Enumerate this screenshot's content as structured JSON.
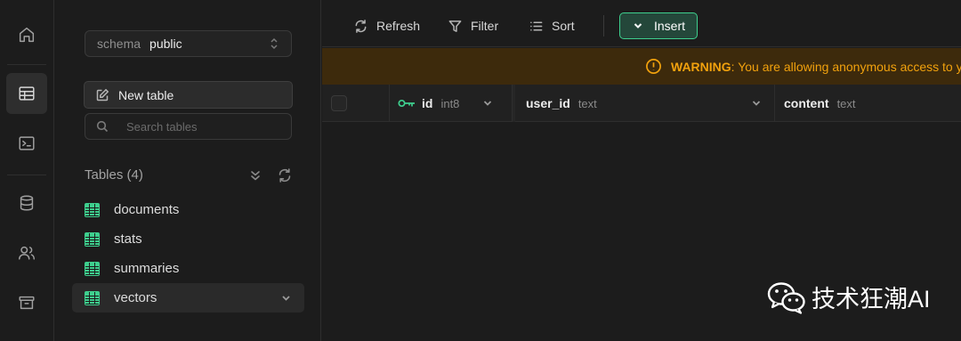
{
  "rail": {
    "items": [
      {
        "icon": "home-icon"
      },
      {
        "icon": "table-editor-icon",
        "active": true
      },
      {
        "icon": "sql-editor-icon"
      },
      {
        "icon": "database-icon"
      },
      {
        "icon": "users-icon"
      },
      {
        "icon": "storage-icon"
      }
    ]
  },
  "sidebar": {
    "schema_label": "schema",
    "schema_value": "public",
    "new_table_label": "New table",
    "search_placeholder": "Search tables",
    "tables_heading": "Tables (4)",
    "tables": [
      {
        "name": "documents"
      },
      {
        "name": "stats"
      },
      {
        "name": "summaries"
      },
      {
        "name": "vectors",
        "active": true
      }
    ]
  },
  "toolbar": {
    "refresh_label": "Refresh",
    "filter_label": "Filter",
    "sort_label": "Sort",
    "insert_label": "Insert"
  },
  "warning": {
    "keyword": "WARNING",
    "text": ": You are allowing anonymous access to y"
  },
  "grid": {
    "columns": [
      {
        "name": "id",
        "type": "int8",
        "primary_key": true
      },
      {
        "name": "user_id",
        "type": "text"
      },
      {
        "name": "content",
        "type": "text"
      }
    ]
  },
  "watermark": {
    "text": "技术狂潮AI"
  },
  "colors": {
    "accent": "#3ecf8e",
    "warning": "#f1a10d",
    "background": "#1c1c1c"
  }
}
